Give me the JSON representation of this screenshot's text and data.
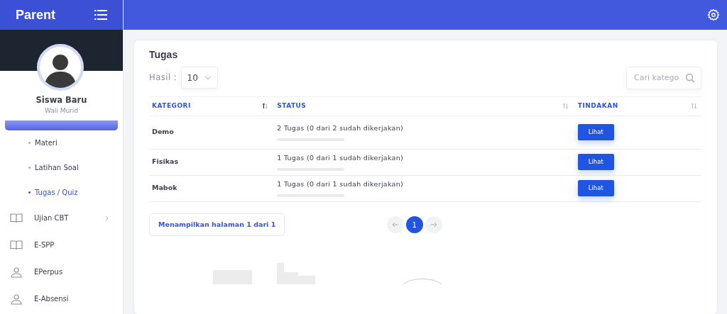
{
  "brand": {
    "title": "Parent"
  },
  "profile": {
    "name": "Siswa Baru",
    "role": "Wali Murid"
  },
  "sidebar": {
    "items": [
      {
        "kind": "bar",
        "children": [
          {
            "label": "Materi",
            "selected": false
          },
          {
            "label": "Latihan Soal",
            "selected": false
          },
          {
            "label": "Tugas / Quiz",
            "selected": true
          }
        ]
      },
      {
        "kind": "book",
        "label": "Ujian CBT",
        "expandable": true
      },
      {
        "kind": "book",
        "label": "E-SPP",
        "expandable": false
      },
      {
        "kind": "person",
        "label": "EPerpus",
        "expandable": false
      },
      {
        "kind": "person",
        "label": "E-Absensi",
        "expandable": false
      }
    ]
  },
  "card": {
    "title": "Tugas",
    "page_size": {
      "label": "Hasil :",
      "value": "10"
    },
    "search": {
      "placeholder": "Cari katego"
    },
    "table": {
      "columns": [
        {
          "label": "KATEGORI",
          "sorted": true
        },
        {
          "label": "STATUS",
          "sorted": false
        },
        {
          "label": "TINDAKAN",
          "sorted": false
        }
      ],
      "rows": [
        {
          "kategori": "Demo",
          "status": "2 Tugas (0 dari 2 sudah dikerjakan)",
          "level": 0,
          "action": "Lihat"
        },
        {
          "kategori": "Fisikas",
          "status": "1 Tugas (0 dari 1 sudah dikerjakan)",
          "level": 0,
          "action": "Lihat"
        },
        {
          "kategori": "Mabok",
          "status": "1 Tugas (0 dari 1 sudah dikerjakan)",
          "level": 0,
          "action": "Lihat"
        }
      ]
    },
    "page_info": "Menampilkan halaman 1 dari 1",
    "pagination": {
      "pages": [
        {
          "label": "1",
          "selected": true
        }
      ]
    }
  }
}
